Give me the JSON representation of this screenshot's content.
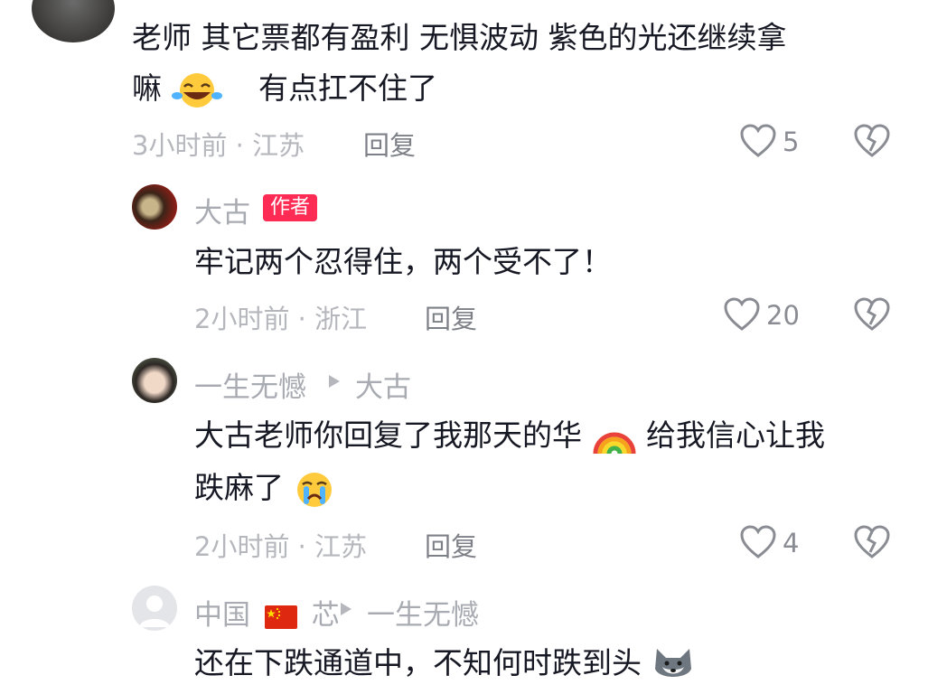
{
  "comments": [
    {
      "line1": "老师 其它票都有盈利 无惧波动 紫色的光还继续拿",
      "line2a": "嘛",
      "line2b": "有点扛不住了",
      "time_loc": "3小时前 · 江苏",
      "reply": "回复",
      "likes": "5"
    },
    {
      "name": "大古",
      "badge": "作者",
      "text": "牢记两个忍得住，两个受不了！",
      "time_loc": "2小时前 · 浙江",
      "reply": "回复",
      "likes": "20"
    },
    {
      "name": "一生无憾",
      "reply_to": "大古",
      "line1a": "大古老师你回复了我那天的华",
      "line1b": "给我信心让我",
      "line2": "跌麻了",
      "time_loc": "2小时前 · 江苏",
      "reply": "回复",
      "likes": "4"
    },
    {
      "name_a": "中国",
      "name_b": "芯",
      "reply_to": "一生无憾",
      "text": "还在下跌通道中，不知何时跌到头"
    }
  ],
  "icons": {
    "like": "heart-outline-icon",
    "dislike": "broken-heart-icon",
    "reply_arrow": "play-triangle-icon"
  },
  "colors": {
    "author_badge": "#fe2c55",
    "meta": "#b5b7bd",
    "text": "#161823"
  }
}
